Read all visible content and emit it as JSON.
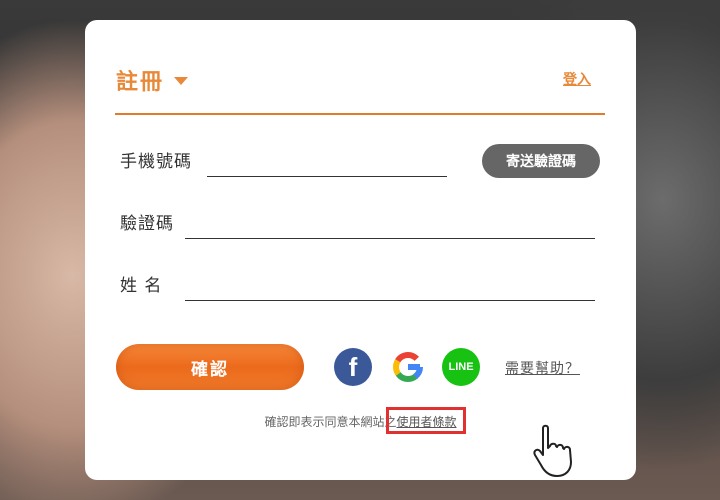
{
  "tabs": {
    "register": "註冊",
    "login": "登入"
  },
  "form": {
    "phone_label": "手機號碼",
    "phone_value": "",
    "send_code_label": "寄送驗證碼",
    "code_label": "驗證碼",
    "code_value": "",
    "name_label": "姓 名",
    "name_value": ""
  },
  "actions": {
    "confirm_label": "確認",
    "help_label": "需要幫助？"
  },
  "social": {
    "facebook_glyph": "f",
    "line_label": "LINE"
  },
  "terms": {
    "prefix": "確認即表示同意本網站之",
    "link": "使用者條款"
  },
  "colors": {
    "accent": "#e8893a",
    "facebook": "#3b5998",
    "line": "#18c213",
    "highlight": "#e03030"
  },
  "icons": [
    "caret-down-icon",
    "facebook-icon",
    "google-icon",
    "line-icon",
    "pointer-hand-icon"
  ]
}
